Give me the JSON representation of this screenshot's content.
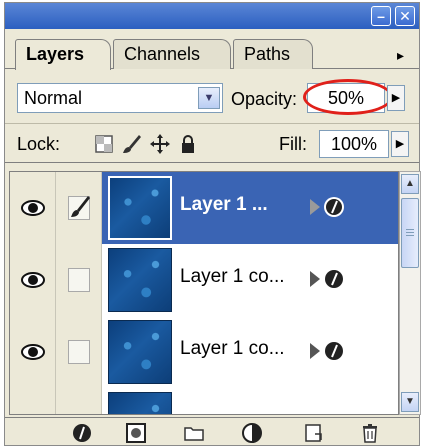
{
  "window": {
    "minimize_glyph": "–",
    "close_glyph": "✕"
  },
  "tabs": [
    {
      "label": "Layers",
      "active": true
    },
    {
      "label": "Channels",
      "active": false
    },
    {
      "label": "Paths",
      "active": false
    }
  ],
  "tab_menu_glyph": "▸",
  "blend": {
    "mode": "Normal",
    "opacity_label": "Opacity:",
    "opacity_value": "50%"
  },
  "lock": {
    "label": "Lock:",
    "fill_label": "Fill:",
    "fill_value": "100%"
  },
  "layers": [
    {
      "name": "Layer 1 ...",
      "selected": true,
      "visible": true,
      "linked_brush": true
    },
    {
      "name": "Layer 1 co...",
      "selected": false,
      "visible": true,
      "linked_brush": false
    },
    {
      "name": "Layer 1 co...",
      "selected": false,
      "visible": true,
      "linked_brush": false
    }
  ],
  "icons": {
    "eye": "eye-icon",
    "brush": "brush-icon",
    "effects": "layer-effects-icon",
    "trash": "trash-icon"
  },
  "colors": {
    "selection": "#3a64b4",
    "highlight_circle": "#e0201a",
    "titlebar": "#2c5fc0"
  }
}
